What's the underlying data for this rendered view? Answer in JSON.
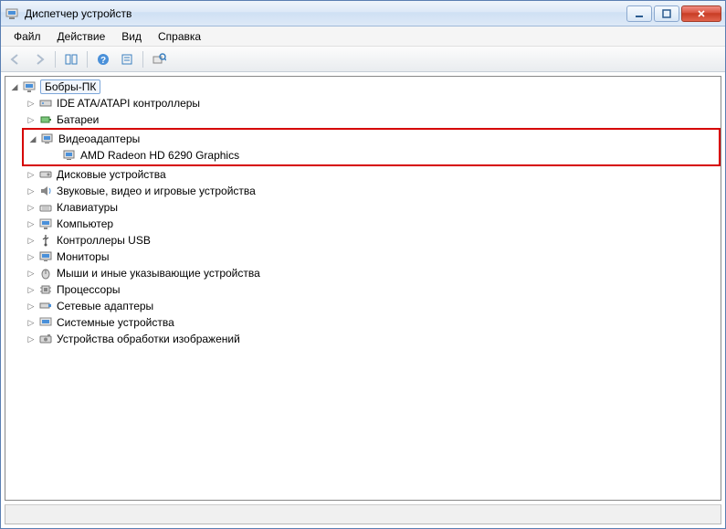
{
  "window": {
    "title": "Диспетчер устройств"
  },
  "menu": {
    "file": "Файл",
    "action": "Действие",
    "view": "Вид",
    "help": "Справка"
  },
  "tree": {
    "root": "Бобры-ПК",
    "nodes": {
      "ide": "IDE ATA/ATAPI контроллеры",
      "battery": "Батареи",
      "video": "Видеоадаптеры",
      "video_child": "AMD Radeon HD 6290 Graphics",
      "disk": "Дисковые устройства",
      "sound": "Звуковые, видео и игровые устройства",
      "keyboard": "Клавиатуры",
      "computer": "Компьютер",
      "usb": "Контроллеры USB",
      "monitor": "Мониторы",
      "mouse": "Мыши и иные указывающие устройства",
      "cpu": "Процессоры",
      "network": "Сетевые адаптеры",
      "system": "Системные устройства",
      "imaging": "Устройства обработки изображений"
    }
  }
}
